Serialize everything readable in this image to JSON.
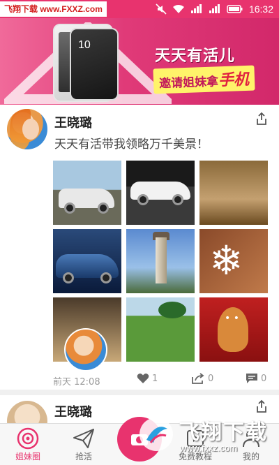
{
  "statusbar": {
    "watermark": "飞翔下载 www.FXXZ.com",
    "time": "16:32"
  },
  "banner": {
    "title": "天天有活儿",
    "subtitle_prefix": "邀请姐妹拿",
    "subtitle_highlight": "手机",
    "phone_time": "10"
  },
  "post": {
    "author": "王晓璐",
    "text": "天天有活带我领略万千美景！",
    "time": "前天 12:08",
    "likes": "1",
    "shares": "0",
    "comments": "0"
  },
  "post2": {
    "author": "王晓璐"
  },
  "tabs": [
    {
      "label": "姐妹圈",
      "icon": "camera-icon",
      "active": true
    },
    {
      "label": "抢活",
      "icon": "paper-plane-icon",
      "active": false
    },
    {
      "label": "",
      "icon": "publish-icon",
      "active": false
    },
    {
      "label": "免费教程",
      "icon": "tutorial-icon",
      "active": false
    },
    {
      "label": "我的",
      "icon": "profile-icon",
      "active": false
    }
  ],
  "brand": {
    "name": "飞翔下载",
    "url": "www.fxxz.com"
  },
  "colors": {
    "accent": "#e8336e"
  }
}
